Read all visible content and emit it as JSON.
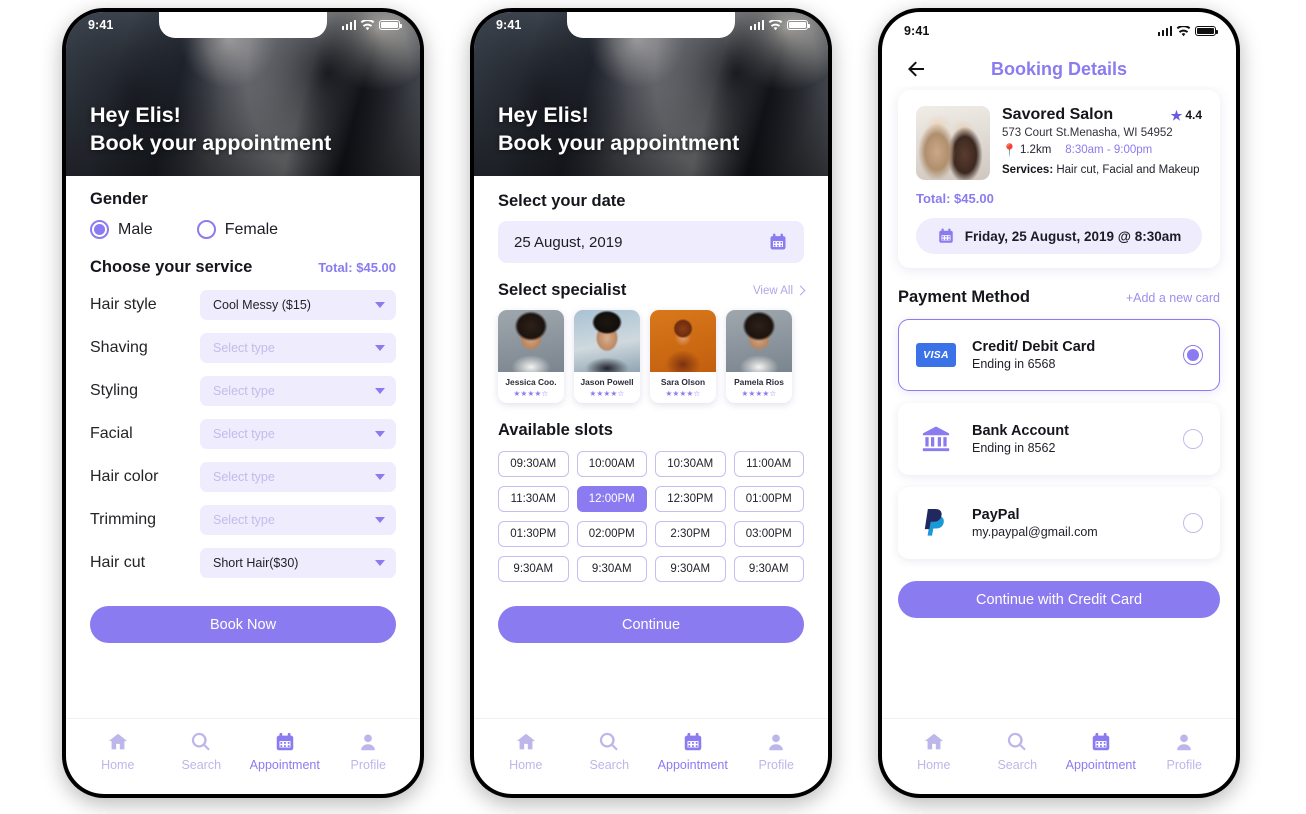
{
  "accent": "#8A7BF0",
  "accent_light": "#EFECFD",
  "status_bar": {
    "time": "9:41"
  },
  "nav": {
    "items": [
      {
        "label": "Home",
        "icon": "home-icon",
        "active": false
      },
      {
        "label": "Search",
        "icon": "search-icon",
        "active": false
      },
      {
        "label": "Appointment",
        "icon": "calendar-icon",
        "active": true
      },
      {
        "label": "Profile",
        "icon": "profile-icon",
        "active": false
      }
    ]
  },
  "screen1": {
    "hero": {
      "line1": "Hey Elis!",
      "line2": "Book your appointment"
    },
    "gender": {
      "title": "Gender",
      "options": [
        {
          "label": "Male",
          "selected": true
        },
        {
          "label": "Female",
          "selected": false
        }
      ]
    },
    "service": {
      "title": "Choose your service",
      "total": "Total: $45.00",
      "placeholder": "Select type",
      "rows": [
        {
          "label": "Hair style",
          "value": "Cool Messy ($15)",
          "filled": true
        },
        {
          "label": "Shaving",
          "value": "Select type",
          "filled": false
        },
        {
          "label": "Styling",
          "value": "Select type",
          "filled": false
        },
        {
          "label": "Facial",
          "value": "Select type",
          "filled": false
        },
        {
          "label": "Hair color",
          "value": "Select type",
          "filled": false
        },
        {
          "label": "Trimming",
          "value": "Select type",
          "filled": false
        },
        {
          "label": "Hair cut",
          "value": "Short Hair($30)",
          "filled": true
        }
      ]
    },
    "book_button": "Book Now"
  },
  "screen2": {
    "hero": {
      "line1": "Hey Elis!",
      "line2": "Book your appointment"
    },
    "date": {
      "title": "Select your date",
      "value": "25 August, 2019",
      "icon": "calendar-icon"
    },
    "specialist": {
      "title": "Select specialist",
      "view_all": "View All",
      "items": [
        {
          "name": "Jessica Coo.",
          "stars": "★★★★☆"
        },
        {
          "name": "Jason Powell",
          "stars": "★★★★☆"
        },
        {
          "name": "Sara Olson",
          "stars": "★★★★☆"
        },
        {
          "name": "Pamela Rios",
          "stars": "★★★★☆"
        }
      ]
    },
    "slots": {
      "title": "Available slots",
      "items": [
        {
          "label": "09:30AM",
          "selected": false
        },
        {
          "label": "10:00AM",
          "selected": false
        },
        {
          "label": "10:30AM",
          "selected": false
        },
        {
          "label": "11:00AM",
          "selected": false
        },
        {
          "label": "11:30AM",
          "selected": false
        },
        {
          "label": "12:00PM",
          "selected": true
        },
        {
          "label": "12:30PM",
          "selected": false
        },
        {
          "label": "01:00PM",
          "selected": false
        },
        {
          "label": "01:30PM",
          "selected": false
        },
        {
          "label": "02:00PM",
          "selected": false
        },
        {
          "label": "2:30PM",
          "selected": false
        },
        {
          "label": "03:00PM",
          "selected": false
        },
        {
          "label": "9:30AM",
          "selected": false
        },
        {
          "label": "9:30AM",
          "selected": false
        },
        {
          "label": "9:30AM",
          "selected": false
        },
        {
          "label": "9:30AM",
          "selected": false
        }
      ]
    },
    "continue_button": "Continue"
  },
  "screen3": {
    "title": "Booking Details",
    "back_icon": "arrow-left-icon",
    "salon": {
      "name": "Savored Salon",
      "rating": "4.4",
      "address": "573 Court St.Menasha, WI 54952",
      "distance": "1.2km",
      "hours": "8:30am - 9:00pm",
      "services_label": "Services:",
      "services_value": "Hair cut, Facial and Makeup",
      "total_label": "Total:",
      "total_value": "$45.00"
    },
    "appointment_chip": "Friday, 25 August, 2019 @ 8:30am",
    "payment": {
      "title": "Payment Method",
      "add_card": "+Add a new card",
      "methods": [
        {
          "name": "Credit/ Debit Card",
          "sub": "Ending in 6568",
          "icon": "visa-icon",
          "badge": "VISA",
          "selected": true
        },
        {
          "name": "Bank Account",
          "sub": "Ending in 8562",
          "icon": "bank-icon",
          "badge": "",
          "selected": false
        },
        {
          "name": "PayPal",
          "sub": "my.paypal@gmail.com",
          "icon": "paypal-icon",
          "badge": "",
          "selected": false
        }
      ]
    },
    "continue_button": "Continue with Credit Card"
  }
}
